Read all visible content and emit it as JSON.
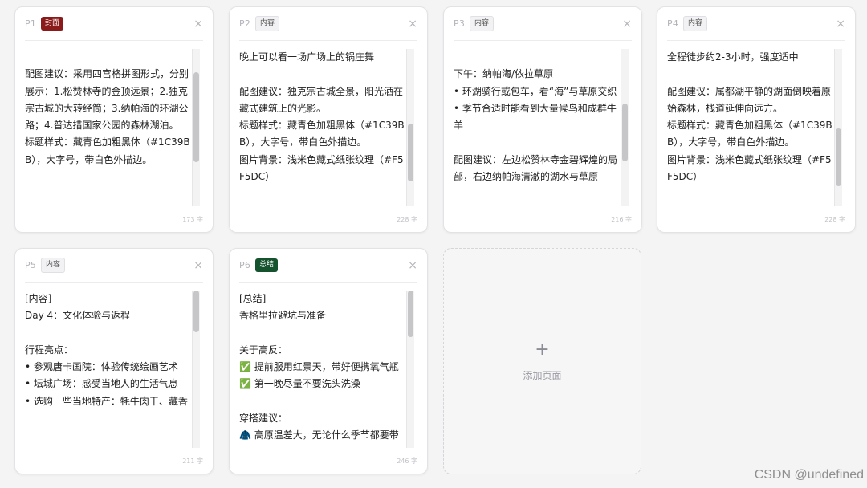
{
  "cards": [
    {
      "page": "P1",
      "badge": "封面",
      "badge_type": "cover",
      "text": "\n配图建议：采用四宫格拼图形式，分别展示：1.松赞林寺的金顶远景；2.独克宗古城的大转经筒；3.纳帕海的环湖公路；4.普达措国家公园的森林湖泊。\n标题样式：藏青色加粗黑体（#1C39BB），大字号，带白色外描边。",
      "count": "173 字",
      "scroll_position": 0.35
    },
    {
      "page": "P2",
      "badge": "内容",
      "badge_type": "content",
      "text": "晚上可以看一场广场上的锅庄舞\n\n配图建议：独克宗古城全景，阳光洒在藏式建筑上的光影。\n标题样式：藏青色加粗黑体（#1C39BB），大字号，带白色外描边。\n图片背景：浅米色藏式纸张纹理（#F5F5DC）",
      "count": "228 字",
      "scroll_position": 0.75
    },
    {
      "page": "P3",
      "badge": "内容",
      "badge_type": "content",
      "text": "\n下午：纳帕海/依拉草原\n• 环湖骑行或包车，看“海”与草原交织\n• 季节合适时能看到大量候鸟和成群牛羊\n\n配图建议：左边松赞林寺金碧辉煌的局部，右边纳帕海清澈的湖水与草原",
      "count": "216 字",
      "scroll_position": 0.55
    },
    {
      "page": "P4",
      "badge": "内容",
      "badge_type": "content",
      "text": "全程徒步约2-3小时，强度适中\n\n配图建议：属都湖平静的湖面倒映着原始森林，栈道延伸向远方。\n标题样式：藏青色加粗黑体（#1C39BB），大字号，带白色外描边。\n图片背景：浅米色藏式纸张纹理（#F5F5DC）",
      "count": "228 字",
      "scroll_position": 0.8
    },
    {
      "page": "P5",
      "badge": "内容",
      "badge_type": "content",
      "text": "[内容]\nDay 4：文化体验与返程\n\n行程亮点：\n• 参观唐卡画院：体验传统绘画艺术\n• 坛城广场：感受当地人的生活气息\n• 选购一些当地特产：牦牛肉干、藏香",
      "count": "211 字",
      "scroll_position": 0.0
    },
    {
      "page": "P6",
      "badge": "总结",
      "badge_type": "summary",
      "text": "[总结]\n香格里拉避坑与准备\n\n关于高反：\n✅ 提前服用红景天，带好便携氧气瓶\n✅ 第一晚尽量不要洗头洗澡\n\n穿搭建议：\n🧥 高原温差大，无论什么季节都要带",
      "count": "246 字",
      "scroll_position": 0.0
    }
  ],
  "close_icon": "×",
  "add_card": {
    "plus": "+",
    "label": "添加页面"
  },
  "watermark": "CSDN @undefined",
  "colors": {
    "cover_badge": "#8b1a1a",
    "summary_badge": "#14532d",
    "background": "#f4f4f5"
  }
}
